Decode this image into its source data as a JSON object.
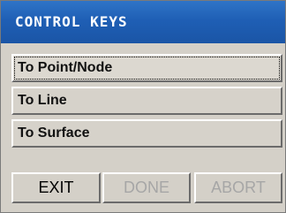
{
  "window": {
    "title": "CONTROL KEYS"
  },
  "list": {
    "items": [
      {
        "label": "To Point/Node",
        "focused": true
      },
      {
        "label": "To Line",
        "focused": false
      },
      {
        "label": "To Surface",
        "focused": false
      }
    ]
  },
  "actions": {
    "exit_label": "EXIT",
    "done_label": "DONE",
    "abort_label": "ABORT",
    "done_enabled": false,
    "abort_enabled": false
  },
  "colors": {
    "titlebar": "#1f5fb5",
    "panel": "#d4d0c8",
    "disabled_text": "#a6a6a6"
  }
}
